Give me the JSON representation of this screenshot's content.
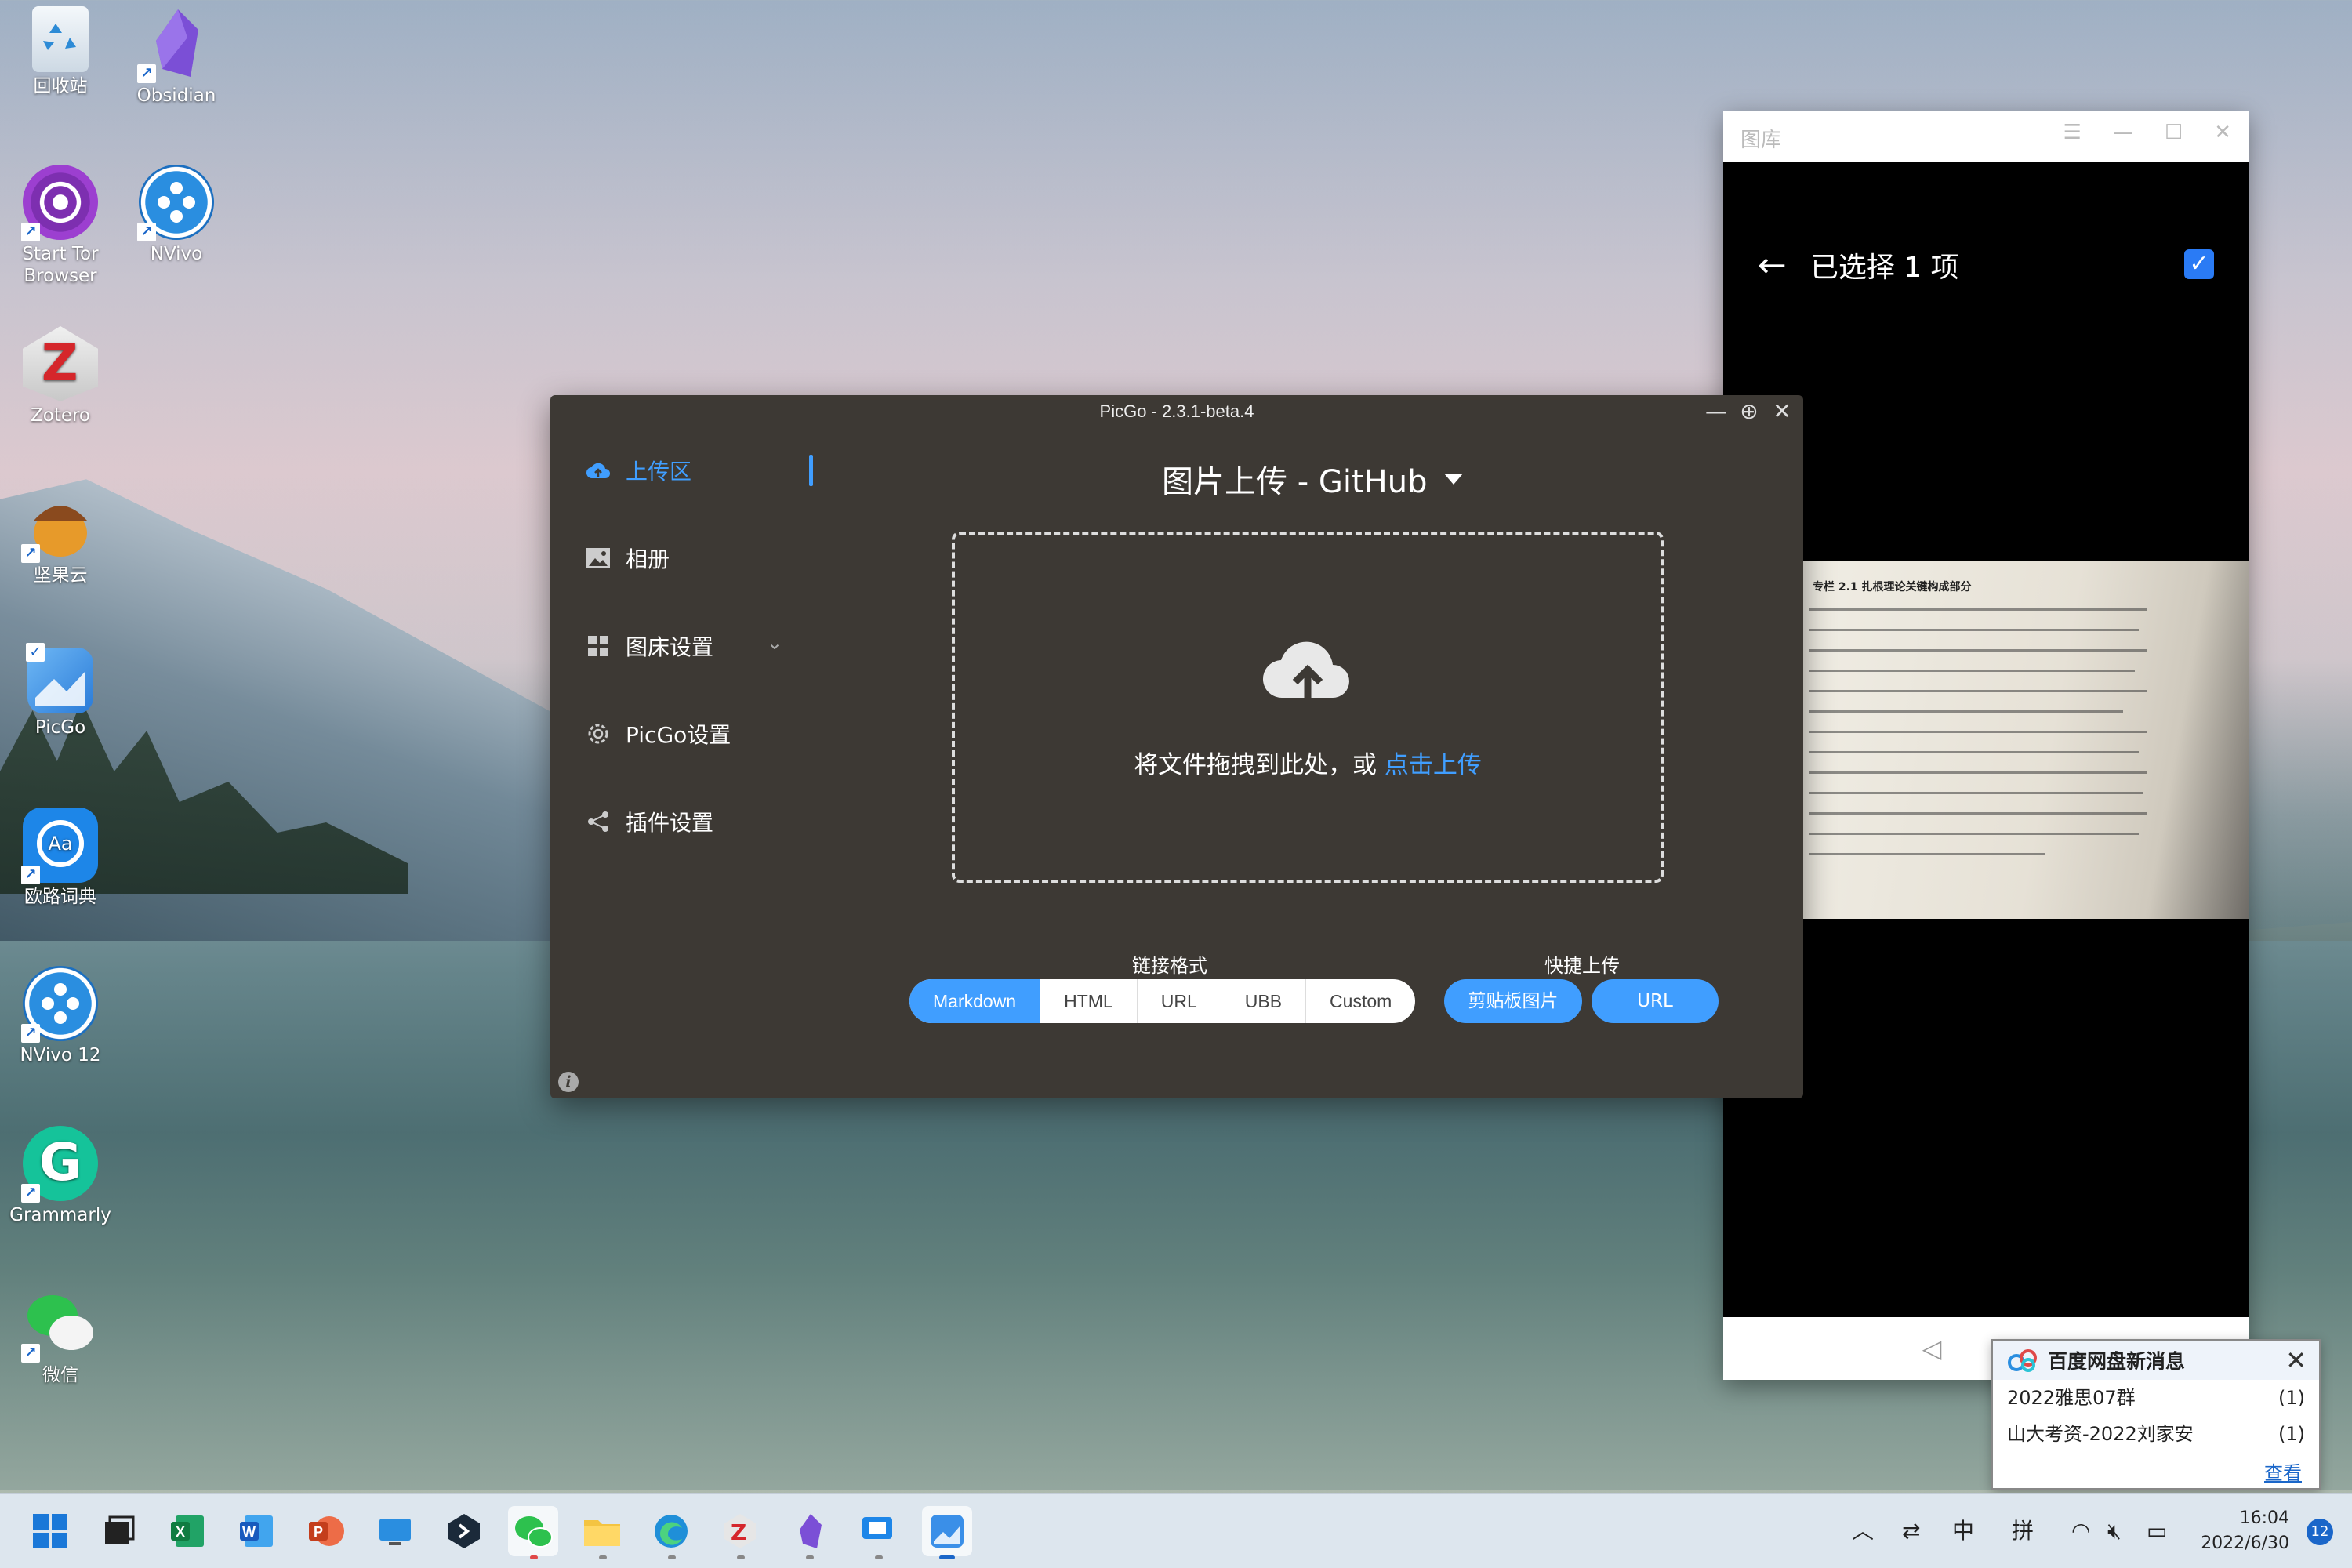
{
  "desktop": {
    "icons": [
      {
        "label": "回收站",
        "icon": "recycle-bin-icon"
      },
      {
        "label": "Obsidian",
        "icon": "obsidian-icon"
      },
      {
        "label": "Start Tor Browser",
        "icon": "tor-browser-icon"
      },
      {
        "label": "NVivo",
        "icon": "nvivo-icon"
      },
      {
        "label": "Zotero",
        "icon": "zotero-icon"
      },
      {
        "label": "坚果云",
        "icon": "nutstore-icon"
      },
      {
        "label": "PicGo",
        "icon": "picgo-icon"
      },
      {
        "label": "欧路词典",
        "icon": "eudic-icon"
      },
      {
        "label": "NVivo 12",
        "icon": "nvivo12-icon"
      },
      {
        "label": "Grammarly",
        "icon": "grammarly-icon"
      },
      {
        "label": "微信",
        "icon": "wechat-icon"
      }
    ]
  },
  "picgo": {
    "title": "PicGo - 2.3.1-beta.4",
    "sidebar": [
      {
        "label": "上传区",
        "icon": "cloud-upload-icon",
        "active": true
      },
      {
        "label": "相册",
        "icon": "image-icon"
      },
      {
        "label": "图床设置",
        "icon": "grid-icon"
      },
      {
        "label": "PicGo设置",
        "icon": "gear-icon"
      },
      {
        "label": "插件设置",
        "icon": "share-icon"
      }
    ],
    "upload_title": "图片上传 - GitHub",
    "drop_text": "将文件拖拽到此处，或 ",
    "drop_link": "点击上传",
    "link_format_label": "链接格式",
    "link_formats": [
      "Markdown",
      "HTML",
      "URL",
      "UBB",
      "Custom"
    ],
    "selected_format": "Markdown",
    "quick_upload_label": "快捷上传",
    "quick_buttons": [
      "剪贴板图片",
      "URL"
    ],
    "accent": "#409eff"
  },
  "gallery": {
    "title": "图库",
    "header": "已选择 1 项",
    "photo_heading": "专栏 2.1   扎根理论关键构成部分"
  },
  "notification": {
    "title": "百度网盘新消息",
    "rows": [
      {
        "name": "2022雅思07群",
        "count": "(1)"
      },
      {
        "name": "山大考资-2022刘家安",
        "count": "(1)"
      }
    ],
    "link": "查看"
  },
  "taskbar": {
    "ime_mode": "中",
    "ime_name": "拼",
    "time": "16:04",
    "date": "2022/6/30",
    "badge": "12"
  }
}
